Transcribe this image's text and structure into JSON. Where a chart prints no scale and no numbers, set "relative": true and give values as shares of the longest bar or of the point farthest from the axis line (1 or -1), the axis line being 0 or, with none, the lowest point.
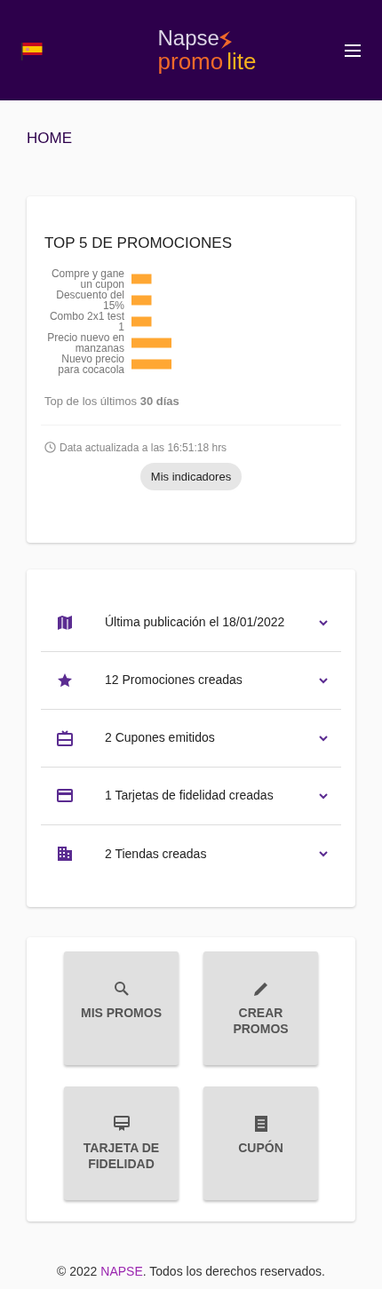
{
  "header": {
    "logo_top": "Napse",
    "logo_bottom": [
      "promo",
      "lite"
    ]
  },
  "page_title": "HOME",
  "top_card": {
    "title": "TOP 5 DE PROMOCIONES",
    "chart_data": {
      "type": "bar",
      "orientation": "horizontal",
      "relative": true,
      "categories": [
        "Compre y gane un cupon",
        "Descuento del 15%",
        "Combo 2x1 test 1",
        "Precio nuevo en manzanas",
        "Nuevo precio para cocacola"
      ],
      "values": [
        0.5,
        0.5,
        0.5,
        1,
        1
      ]
    },
    "period": "Top de los últimos **30 días**",
    "updated": "Data actualizada a las 16:51:18 hrs",
    "button": "Mis indicadores"
  },
  "summary": [
    {
      "kind": "map",
      "label": "Última publicación el 18/01/2022",
      "expanded": false
    },
    {
      "kind": "star",
      "label": "12 Promociones creadas",
      "expanded": false
    },
    {
      "kind": "gift",
      "label": "2 Cupones emitidos",
      "expanded": false
    },
    {
      "kind": "card",
      "label": "1 Tarjetas de fidelidad creadas",
      "expanded": false
    },
    {
      "kind": "building",
      "label": "2 Tiendas creadas",
      "expanded": false
    }
  ],
  "actions": [
    {
      "kind": "search",
      "label": "MIS PROMOS"
    },
    {
      "kind": "pencil",
      "label": "CREAR PROMOS"
    },
    {
      "kind": "loyalty",
      "label": "TARJETA DE FIDELIDAD"
    },
    {
      "kind": "receipt",
      "label": "CUPÓN"
    }
  ],
  "footer": {
    "prefix": "© 2022 ",
    "link": "NAPSE",
    "suffix": ". Todos los derechos reservados."
  }
}
